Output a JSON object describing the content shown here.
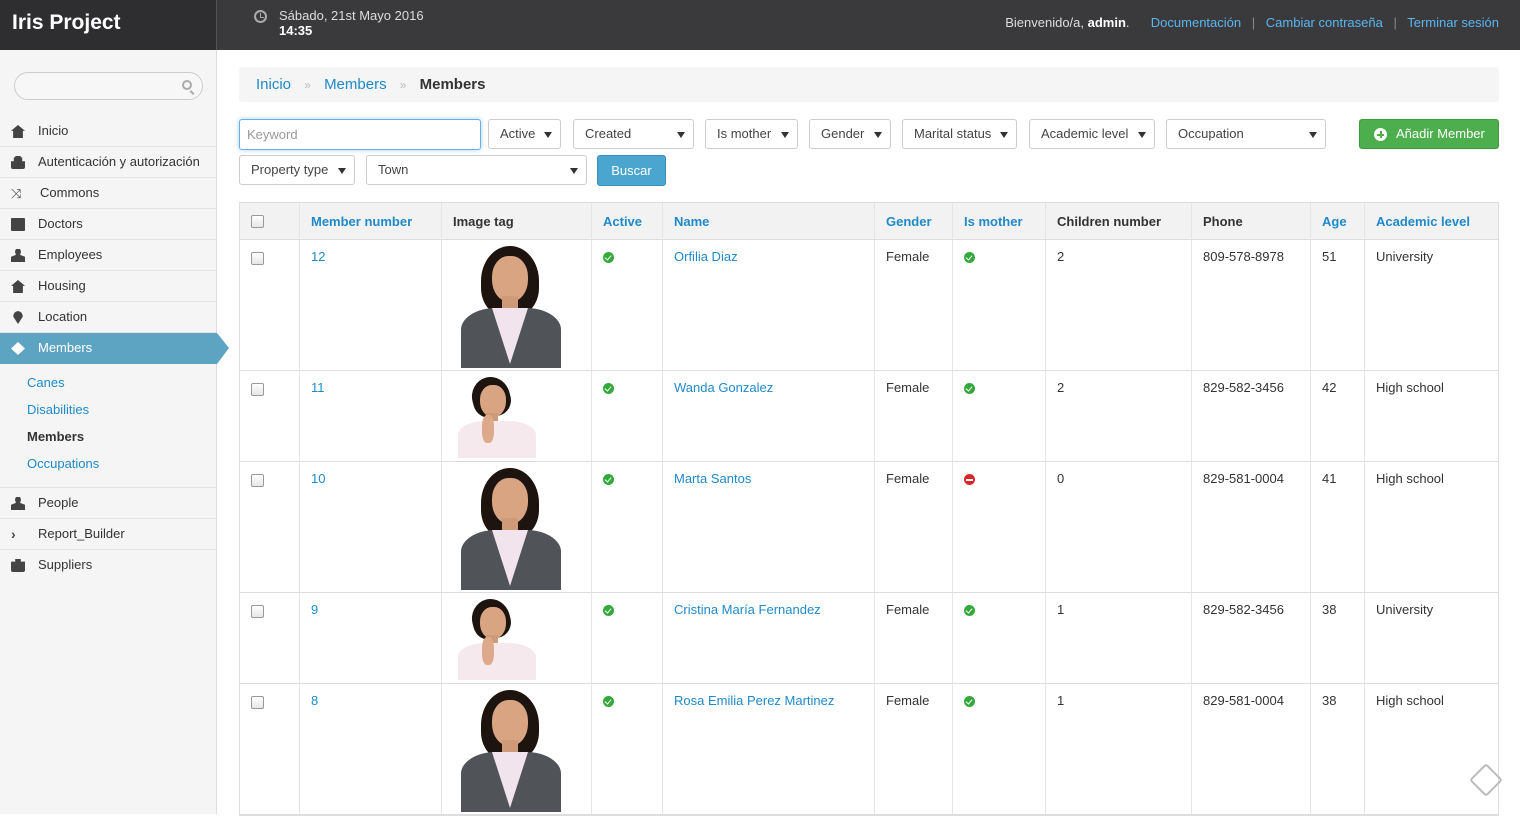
{
  "app": {
    "title": "Iris Project",
    "date": "Sábado, 21st Mayo 2016",
    "time": "14:35",
    "welcome_prefix": "Bienvenido/a,",
    "user": "admin",
    "welcome_suffix": ".",
    "links": [
      "Documentación",
      "Cambiar contraseña",
      "Terminar sesión"
    ]
  },
  "sidebar": {
    "search_placeholder": "",
    "items": [
      {
        "label": "Inicio",
        "icon": "home-icon"
      },
      {
        "label": "Autenticación y autorización",
        "icon": "lock-icon"
      },
      {
        "label": "Commons",
        "icon": "shuffle-icon"
      },
      {
        "label": "Doctors",
        "icon": "calendar-icon"
      },
      {
        "label": "Employees",
        "icon": "user-icon"
      },
      {
        "label": "Housing",
        "icon": "home-icon"
      },
      {
        "label": "Location",
        "icon": "map-pin-icon"
      },
      {
        "label": "Members",
        "icon": "members-icon",
        "active": true
      }
    ],
    "subitems": [
      {
        "label": "Canes"
      },
      {
        "label": "Disabilities"
      },
      {
        "label": "Members",
        "current": true
      },
      {
        "label": "Occupations"
      }
    ],
    "items_after": [
      {
        "label": "People",
        "icon": "user-icon"
      },
      {
        "label": "Report_Builder",
        "icon": "chevron-right-icon"
      },
      {
        "label": "Suppliers",
        "icon": "briefcase-icon"
      }
    ]
  },
  "breadcrumb": {
    "items": [
      "Inicio",
      "Members"
    ],
    "current": "Members",
    "separator": "»"
  },
  "filters": {
    "keyword_placeholder": "Keyword",
    "selects": [
      "Active",
      "Created",
      "Is mother",
      "Gender",
      "Marital status",
      "Academic level",
      "Occupation",
      "Property type",
      "Town"
    ],
    "search_button": "Buscar",
    "add_button": "Añadir Member"
  },
  "table": {
    "columns": [
      "Member number",
      "Image tag",
      "Active",
      "Name",
      "Gender",
      "Is mother",
      "Children number",
      "Phone",
      "Age",
      "Academic level"
    ],
    "rows": [
      {
        "number": "12",
        "photo": "portrait-a",
        "active": true,
        "name": "Orfilia Diaz",
        "gender": "Female",
        "is_mother": true,
        "children": "2",
        "phone": "809-578-8978",
        "age": "51",
        "academic": "University"
      },
      {
        "number": "11",
        "photo": "portrait-b",
        "active": true,
        "name": "Wanda Gonzalez",
        "gender": "Female",
        "is_mother": true,
        "children": "2",
        "phone": "829-582-3456",
        "age": "42",
        "academic": "High school"
      },
      {
        "number": "10",
        "photo": "portrait-a",
        "active": true,
        "name": "Marta Santos",
        "gender": "Female",
        "is_mother": false,
        "children": "0",
        "phone": "829-581-0004",
        "age": "41",
        "academic": "High school"
      },
      {
        "number": "9",
        "photo": "portrait-b",
        "active": true,
        "name": "Cristina María Fernandez",
        "gender": "Female",
        "is_mother": true,
        "children": "1",
        "phone": "829-582-3456",
        "age": "38",
        "academic": "University"
      },
      {
        "number": "8",
        "photo": "portrait-a",
        "active": true,
        "name": "Rosa Emilia Perez Martinez",
        "gender": "Female",
        "is_mother": true,
        "children": "1",
        "phone": "829-581-0004",
        "age": "38",
        "academic": "High school"
      }
    ]
  },
  "colors": {
    "topbar": "#3a3a3c",
    "link": "#1f8ac9",
    "active_nav": "#5da4c3",
    "add_button": "#4cae4c",
    "search_button": "#4ba6cf",
    "ok": "#34a93b",
    "no": "#d9262b"
  }
}
